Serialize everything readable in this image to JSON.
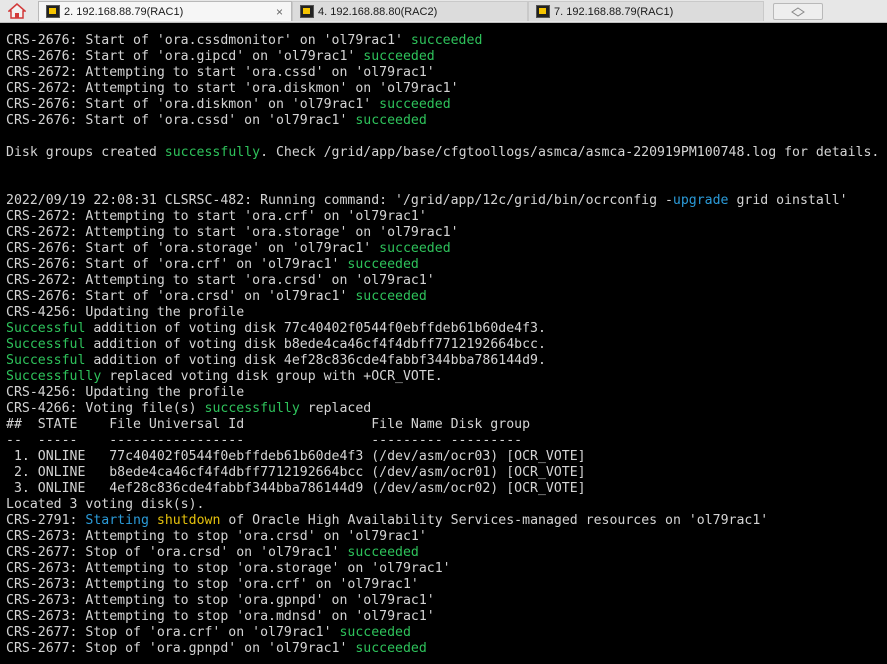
{
  "tabs": [
    {
      "label": "2. 192.168.88.79(RAC1)",
      "close": "×",
      "active": true
    },
    {
      "label": "4. 192.168.88.80(RAC2)",
      "active": false
    },
    {
      "label": "7. 192.168.88.79(RAC1)",
      "active": false
    }
  ],
  "terminal": {
    "lines": [
      [
        [
          "CRS-2676: Start of 'ora.cssdmonitor' on 'ol79rac1' ",
          ""
        ],
        [
          "succeeded",
          "g"
        ]
      ],
      [
        [
          "CRS-2676: Start of 'ora.gipcd' on 'ol79rac1' ",
          ""
        ],
        [
          "succeeded",
          "g"
        ]
      ],
      [
        [
          "CRS-2672: Attempting to start 'ora.cssd' on 'ol79rac1'",
          ""
        ]
      ],
      [
        [
          "CRS-2672: Attempting to start 'ora.diskmon' on 'ol79rac1'",
          ""
        ]
      ],
      [
        [
          "CRS-2676: Start of 'ora.diskmon' on 'ol79rac1' ",
          ""
        ],
        [
          "succeeded",
          "g"
        ]
      ],
      [
        [
          "CRS-2676: Start of 'ora.cssd' on 'ol79rac1' ",
          ""
        ],
        [
          "succeeded",
          "g"
        ]
      ],
      [],
      [
        [
          "Disk groups created ",
          ""
        ],
        [
          "successfully",
          "g"
        ],
        [
          ". Check /grid/app/base/cfgtoollogs/asmca/asmca-220919PM100748.log for details.",
          ""
        ]
      ],
      [],
      [],
      [
        [
          "2022/09/19 22:08:31 CLSRSC-482: Running command: '/grid/app/12c/grid/bin/ocrconfig -",
          ""
        ],
        [
          "upgrade",
          "b"
        ],
        [
          " grid oinstall'",
          ""
        ]
      ],
      [
        [
          "CRS-2672: Attempting to start 'ora.crf' on 'ol79rac1'",
          ""
        ]
      ],
      [
        [
          "CRS-2672: Attempting to start 'ora.storage' on 'ol79rac1'",
          ""
        ]
      ],
      [
        [
          "CRS-2676: Start of 'ora.storage' on 'ol79rac1' ",
          ""
        ],
        [
          "succeeded",
          "g"
        ]
      ],
      [
        [
          "CRS-2676: Start of 'ora.crf' on 'ol79rac1' ",
          ""
        ],
        [
          "succeeded",
          "g"
        ]
      ],
      [
        [
          "CRS-2672: Attempting to start 'ora.crsd' on 'ol79rac1'",
          ""
        ]
      ],
      [
        [
          "CRS-2676: Start of 'ora.crsd' on 'ol79rac1' ",
          ""
        ],
        [
          "succeeded",
          "g"
        ]
      ],
      [
        [
          "CRS-4256: Updating the profile",
          ""
        ]
      ],
      [
        [
          "Successful",
          "g"
        ],
        [
          " addition of voting disk 77c40402f0544f0ebffdeb61b60de4f3.",
          ""
        ]
      ],
      [
        [
          "Successful",
          "g"
        ],
        [
          " addition of voting disk b8ede4ca46cf4f4dbff7712192664bcc.",
          ""
        ]
      ],
      [
        [
          "Successful",
          "g"
        ],
        [
          " addition of voting disk 4ef28c836cde4fabbf344bba786144d9.",
          ""
        ]
      ],
      [
        [
          "Successfully",
          "g"
        ],
        [
          " replaced voting disk group with +OCR_VOTE.",
          ""
        ]
      ],
      [
        [
          "CRS-4256: Updating the profile",
          ""
        ]
      ],
      [
        [
          "CRS-4266: Voting file(s) ",
          ""
        ],
        [
          "successfully",
          "g"
        ],
        [
          " replaced",
          ""
        ]
      ],
      [
        [
          "##  STATE    File Universal Id                File Name Disk group",
          ""
        ]
      ],
      [
        [
          "--  -----    -----------------                --------- ---------",
          ""
        ]
      ],
      [
        [
          " 1. ONLINE   77c40402f0544f0ebffdeb61b60de4f3 (/dev/asm/ocr03) [OCR_VOTE]",
          ""
        ]
      ],
      [
        [
          " 2. ONLINE   b8ede4ca46cf4f4dbff7712192664bcc (/dev/asm/ocr01) [OCR_VOTE]",
          ""
        ]
      ],
      [
        [
          " 3. ONLINE   4ef28c836cde4fabbf344bba786144d9 (/dev/asm/ocr02) [OCR_VOTE]",
          ""
        ]
      ],
      [
        [
          "Located 3 voting disk(s).",
          ""
        ]
      ],
      [
        [
          "CRS-2791: ",
          ""
        ],
        [
          "Starting",
          "b"
        ],
        [
          " ",
          ""
        ],
        [
          "shutdown",
          "y"
        ],
        [
          " of Oracle High Availability Services-managed resources on 'ol79rac1'",
          ""
        ]
      ],
      [
        [
          "CRS-2673: Attempting to stop 'ora.crsd' on 'ol79rac1'",
          ""
        ]
      ],
      [
        [
          "CRS-2677: Stop of 'ora.crsd' on 'ol79rac1' ",
          ""
        ],
        [
          "succeeded",
          "g"
        ]
      ],
      [
        [
          "CRS-2673: Attempting to stop 'ora.storage' on 'ol79rac1'",
          ""
        ]
      ],
      [
        [
          "CRS-2673: Attempting to stop 'ora.crf' on 'ol79rac1'",
          ""
        ]
      ],
      [
        [
          "CRS-2673: Attempting to stop 'ora.gpnpd' on 'ol79rac1'",
          ""
        ]
      ],
      [
        [
          "CRS-2673: Attempting to stop 'ora.mdnsd' on 'ol79rac1'",
          ""
        ]
      ],
      [
        [
          "CRS-2677: Stop of 'ora.crf' on 'ol79rac1' ",
          ""
        ],
        [
          "succeeded",
          "g"
        ]
      ],
      [
        [
          "CRS-2677: Stop of 'ora.gpnpd' on 'ol79rac1' ",
          ""
        ],
        [
          "succeeded",
          "g"
        ]
      ]
    ]
  },
  "colors": {
    "success_green": "#2ec25b",
    "keyword_blue": "#2b9bd9",
    "keyword_yellow": "#e5c10c",
    "text_default": "#d4d4d4",
    "background": "#000000"
  }
}
